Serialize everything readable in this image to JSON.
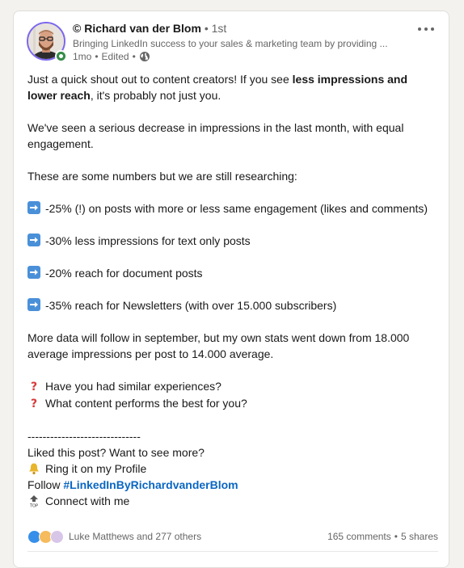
{
  "post": {
    "author": {
      "name": "© Richard van der Blom",
      "degree": "1st",
      "separator": "•",
      "headline": "Bringing LinkedIn success to your sales & marketing team by providing ...",
      "time": "1mo",
      "edited": "Edited",
      "meta_separator": "•"
    },
    "body": {
      "p1_a": "Just a quick shout out to content creators! If you see ",
      "p1_bold": "less impressions and lower reach",
      "p1_b": ", it's probably not just you.",
      "p2": "We've seen a serious decrease in impressions in the last month, with equal engagement.",
      "p3": "These are some numbers but we are still researching:",
      "bullets": [
        "-25% (!) on posts with more or less same engagement (likes and comments)",
        "-30% less impressions for text only posts",
        "-20% reach for document posts",
        "-35% reach for Newsletters (with over 15.000 subscribers)"
      ],
      "p4": "More data will follow in september, but my own stats went down from 18.000 average impressions per post to 14.000 average.",
      "questions": [
        "Have you had similar experiences?",
        "What content performs the best for you?"
      ],
      "rule": "------------------------------",
      "cta": "Liked this post? Want to see more?",
      "ring": "Ring it on my Profile",
      "follow_prefix": "Follow ",
      "hashtag": "#LinkedInByRichardvanderBlom",
      "connect": "Connect with me"
    },
    "social": {
      "reactors": "Luke Matthews and 277 others",
      "comments": "165 comments",
      "separator": "•",
      "shares": "5 shares"
    }
  },
  "colors": {
    "link": "#0a66c2",
    "online": "#378d4a",
    "avatar_ring": "#7b68ee",
    "question_mark": "#d93a3a",
    "arrow_emoji": "#4a90d9"
  },
  "icons": {
    "more": "three-dots-icon",
    "visibility": "globe-icon",
    "bullet": "right-arrow-emoji-icon",
    "question": "red-question-mark-icon",
    "bell": "bell-icon",
    "top": "top-arrow-icon"
  }
}
